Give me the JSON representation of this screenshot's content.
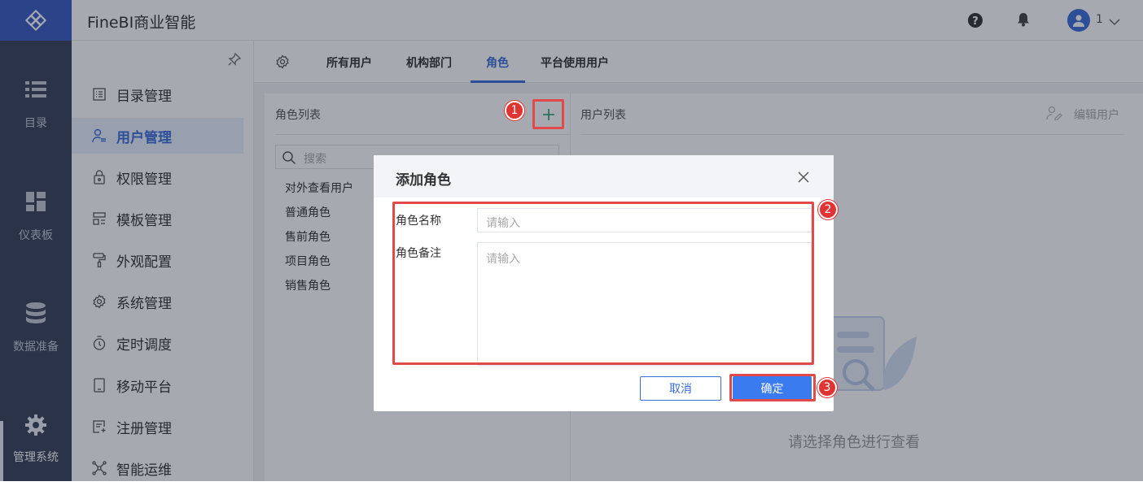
{
  "header": {
    "app_title": "FineBI商业智能",
    "user_name": "1"
  },
  "rail": {
    "items": [
      "目录",
      "仪表板",
      "数据准备",
      "管理系统"
    ]
  },
  "sidebar": {
    "items": [
      "目录管理",
      "用户管理",
      "权限管理",
      "模板管理",
      "外观配置",
      "系统管理",
      "定时调度",
      "移动平台",
      "注册管理",
      "智能运维"
    ]
  },
  "tabs": [
    "所有用户",
    "机构部门",
    "角色",
    "平台使用用户"
  ],
  "role_panel": {
    "title": "角色列表",
    "search_placeholder": "搜索",
    "roles": [
      "对外查看用户",
      "普通角色",
      "售前角色",
      "项目角色",
      "销售角色"
    ]
  },
  "user_panel": {
    "title": "用户列表",
    "edit_label": "编辑用户",
    "empty_text": "请选择角色进行查看"
  },
  "dialog": {
    "title": "添加角色",
    "name_label": "角色名称",
    "name_placeholder": "请输入",
    "note_label": "角色备注",
    "note_placeholder": "请输入",
    "cancel_label": "取消",
    "ok_label": "确定"
  },
  "badges": [
    "1",
    "2",
    "3"
  ],
  "colors": {
    "accent": "#3a6fd8",
    "rail": "#37425a",
    "highlight": "#e14a4a"
  }
}
